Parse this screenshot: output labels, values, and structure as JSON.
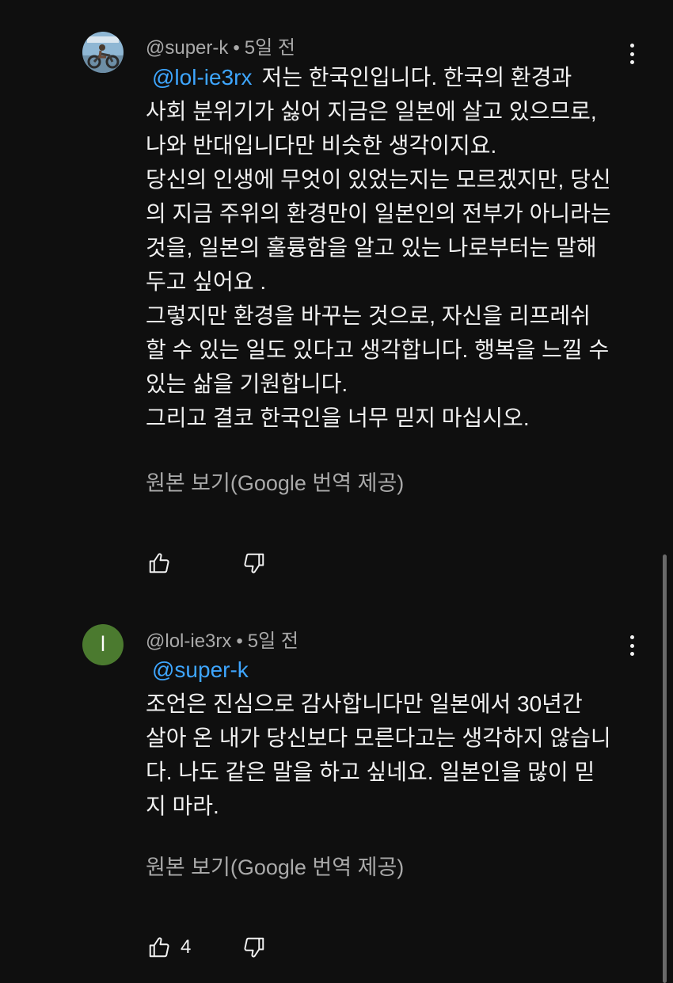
{
  "comments": [
    {
      "author": "@super-k",
      "separator": "•",
      "time": "5일 전",
      "mention": "@lol-ie3rx",
      "lines": [
        "저는 한국인입니다. 한국의 환경과",
        "사회 분위기가 싫어 지금은 일본에 살고 있으므로,",
        "나와 반대입니다만 비슷한 생각이지요.",
        "당신의 인생에 무엇이 있었는지는 모르겠지만, 당신",
        "의 지금 주위의 환경만이 일본인의 전부가 아니라는",
        "것을, 일본의 훌륭함을 알고 있는 나로부터는 말해",
        "두고 싶어요 .",
        "그렇지만 환경을 바꾸는 것으로, 자신을 리프레쉬",
        "할 수 있는 일도 있다고 생각합니다. 행복을 느낄 수",
        "있는 삶을 기원합니다.",
        "그리고 결코 한국인을 너무 믿지 마십시오."
      ],
      "translate_link": "원본 보기(Google 번역 제공)",
      "like_count": ""
    },
    {
      "author": "@lol-ie3rx",
      "separator": "•",
      "time": "5일 전",
      "avatar_letter": "l",
      "avatar_color": "#4b7a2f",
      "mention": "@super-k",
      "lines": [
        "조언은 진심으로 감사합니다만 일본에서 30년간",
        "살아 온 내가 당신보다 모른다고는 생각하지 않습니",
        "다. 나도 같은 말을 하고 싶네요. 일본인을 많이 믿",
        "지 마라."
      ],
      "translate_link": "원본 보기(Google 번역 제공)",
      "like_count": "4"
    }
  ],
  "icons": {
    "like": "thumb-up-icon",
    "dislike": "thumb-down-icon",
    "more": "more-vert-icon"
  },
  "colors": {
    "background": "#0f0f0f",
    "text": "#f1f1f1",
    "secondary_text": "#aaaaaa",
    "mention": "#3ea6ff"
  }
}
